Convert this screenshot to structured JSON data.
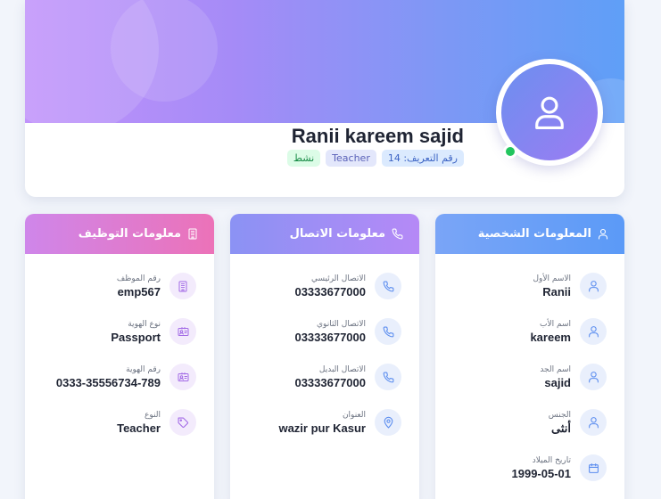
{
  "profile": {
    "name": "Ranii kareem sajid",
    "badges": {
      "id": "رقم التعريف: 14",
      "role": "Teacher",
      "status": "نشط"
    },
    "online": true
  },
  "cards": {
    "personal": {
      "title": "المعلومات الشخصية",
      "rows": [
        {
          "label": "الاسم الأول",
          "value": "Ranii",
          "icon": "user-icon"
        },
        {
          "label": "اسم الأب",
          "value": "kareem",
          "icon": "user-icon"
        },
        {
          "label": "اسم الجد",
          "value": "sajid",
          "icon": "user-icon"
        },
        {
          "label": "الجنس",
          "value": "أنثى",
          "icon": "user-icon"
        },
        {
          "label": "تاريخ الميلاد",
          "value": "1999-05-01",
          "icon": "calendar-icon"
        }
      ]
    },
    "contact": {
      "title": "معلومات الاتصال",
      "rows": [
        {
          "label": "الاتصال الرئيسي",
          "value": "03333677000",
          "icon": "phone-icon"
        },
        {
          "label": "الاتصال الثانوي",
          "value": "03333677000",
          "icon": "phone-icon"
        },
        {
          "label": "الاتصال البديل",
          "value": "03333677000",
          "icon": "phone-icon"
        },
        {
          "label": "العنوان",
          "value": "wazir pur Kasur",
          "icon": "location-pin-icon"
        }
      ]
    },
    "employment": {
      "title": "معلومات التوظيف",
      "rows": [
        {
          "label": "رقم الموظف",
          "value": "emp567",
          "icon": "building-icon"
        },
        {
          "label": "نوع الهوية",
          "value": "Passport",
          "icon": "id-card-icon"
        },
        {
          "label": "رقم الهوية",
          "value": "0333-35556734-789",
          "icon": "id-card-icon"
        },
        {
          "label": "النوع",
          "value": "Teacher",
          "icon": "tag-icon"
        }
      ]
    }
  },
  "colors": {
    "online": "#22c55e",
    "personal_header": "#5b9af7",
    "contact_header": "#9a8ef5",
    "employment_header": "#e47ac8"
  }
}
